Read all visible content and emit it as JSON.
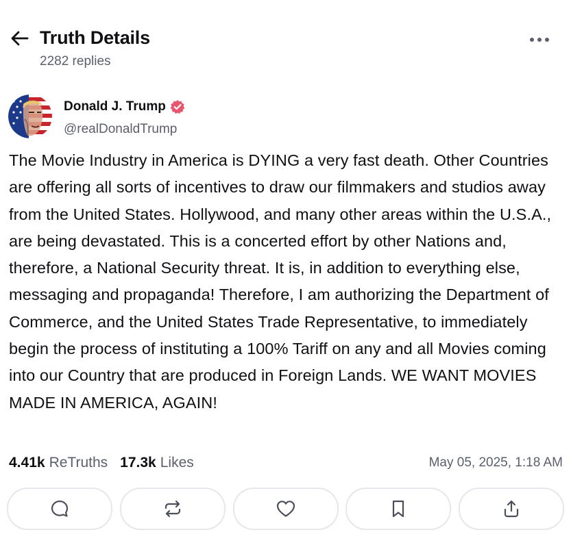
{
  "header": {
    "title": "Truth Details",
    "reply_count": "2282 replies",
    "back_icon": "arrow-left-icon",
    "more_icon": "ellipsis-icon"
  },
  "author": {
    "name": "Donald J. Trump",
    "handle": "@realDonaldTrump",
    "verified": true,
    "verified_color": "#e8556e"
  },
  "post": {
    "text": "The Movie Industry in America is DYING a very fast death. Other Countries are offering all sorts of incentives to draw our filmmakers and studios away from the United States. Hollywood, and many other areas within the U.S.A., are being devastated. This is a concerted effort by other Nations and, therefore, a National Security threat. It is, in addition to everything else, messaging and propaganda! Therefore, I am authorizing the Department of Commerce, and the United States Trade Representative, to immediately begin the process of instituting a 100% Tariff on any and all Movies coming into our Country that are produced in Foreign Lands. WE WANT MOVIES MADE IN AMERICA, AGAIN!"
  },
  "stats": {
    "retruths_count": "4.41k",
    "retruths_label": "ReTruths",
    "likes_count": "17.3k",
    "likes_label": "Likes",
    "timestamp": "May 05, 2025, 1:18 AM"
  },
  "actions": [
    {
      "name": "reply",
      "icon": "comment-icon"
    },
    {
      "name": "retruth",
      "icon": "repost-icon"
    },
    {
      "name": "like",
      "icon": "heart-icon"
    },
    {
      "name": "bookmark",
      "icon": "bookmark-icon"
    },
    {
      "name": "share",
      "icon": "share-icon"
    }
  ],
  "colors": {
    "text_primary": "#0f0f14",
    "text_secondary": "#5b5f6b",
    "border": "#e6e7eb",
    "icon": "#4a4e58"
  }
}
